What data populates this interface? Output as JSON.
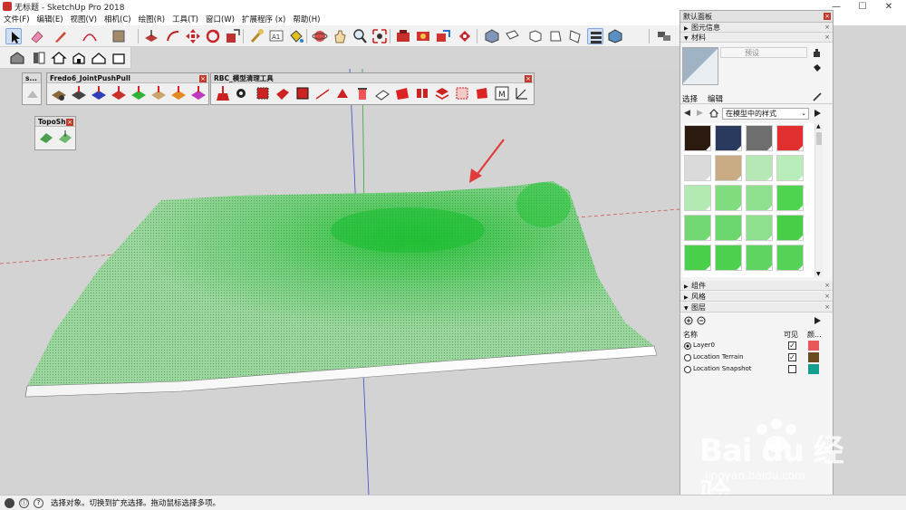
{
  "window": {
    "title": "无标题 - SketchUp Pro 2018",
    "minimize": "—",
    "maximize": "☐",
    "close": "✕"
  },
  "menu": [
    "文件(F)",
    "编辑(E)",
    "视图(V)",
    "相机(C)",
    "绘图(R)",
    "工具(T)",
    "窗口(W)",
    "扩展程序 (x)",
    "帮助(H)"
  ],
  "floating_toolbars": {
    "small": {
      "title": "s..."
    },
    "fredo": {
      "title": "Fredo6_JointPushPull"
    },
    "rbc": {
      "title": "RBC_模型清理工具"
    },
    "topo": {
      "title": "TopoSh..."
    }
  },
  "tray": {
    "title": "默认面板",
    "entity_info": "图元信息",
    "materials": "材料",
    "material_name_placeholder": "预设",
    "tab_select": "选择",
    "tab_edit": "编辑",
    "library_dropdown": "在模型中的样式",
    "components": "组件",
    "styles": "风格",
    "layers": "图层",
    "layer_cols": {
      "name": "名称",
      "visible": "可见",
      "color": "颜..."
    },
    "layer_rows": [
      {
        "name": "Layer0",
        "active": true,
        "visible": true,
        "color": "#e8585a"
      },
      {
        "name": "Location Terrain",
        "active": false,
        "visible": true,
        "color": "#6b4a1e"
      },
      {
        "name": "Location Snapshot",
        "active": false,
        "visible": false,
        "color": "#139e8d"
      }
    ],
    "swatches": [
      "#2b1a10",
      "#2a3a5e",
      "#6e6e6e",
      "#e12e2e",
      "#dadada",
      "#c9ab84",
      "#b5e8b5",
      "#b8ecb8",
      "#b2eab2",
      "#7fdc7f",
      "#8ee08e",
      "#4fd44f",
      "#73d873",
      "#6bd66b",
      "#8ee08e",
      "#47cf47",
      "#49cf49",
      "#4dd04d",
      "#60d460",
      "#56d256"
    ]
  },
  "status": {
    "text": "选择对象。切换到扩充选择。拖动鼠标选择多项。"
  },
  "watermark": {
    "brand": "Bai du 经验",
    "url": "jingyan.baidu.com"
  }
}
